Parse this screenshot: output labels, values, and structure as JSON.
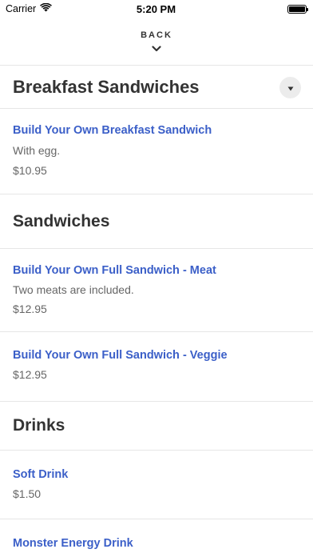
{
  "status_bar": {
    "carrier": "Carrier",
    "time": "5:20 PM",
    "battery_level": 1.0
  },
  "header": {
    "back_label": "BACK"
  },
  "categories": [
    {
      "title": "Breakfast Sandwiches",
      "items": [
        {
          "name": "Build Your Own Breakfast Sandwich",
          "description": "With egg.",
          "price": "$10.95"
        }
      ]
    },
    {
      "title": "Sandwiches",
      "items": [
        {
          "name": "Build Your Own Full Sandwich - Meat",
          "description": "Two meats are included.",
          "price": "$12.95"
        },
        {
          "name": "Build Your Own Full Sandwich - Veggie",
          "price": "$12.95"
        }
      ]
    },
    {
      "title": "Drinks",
      "items": [
        {
          "name": "Soft Drink",
          "price": "$1.50"
        },
        {
          "name": "Monster Energy Drink"
        }
      ]
    }
  ],
  "colors": {
    "link": "#3b5fc8",
    "text": "#333333",
    "muted": "#666666",
    "divider": "#e6e6e6"
  },
  "icons": [
    "wifi-icon",
    "battery-icon",
    "chevron-down-icon",
    "dropdown-caret-icon"
  ]
}
